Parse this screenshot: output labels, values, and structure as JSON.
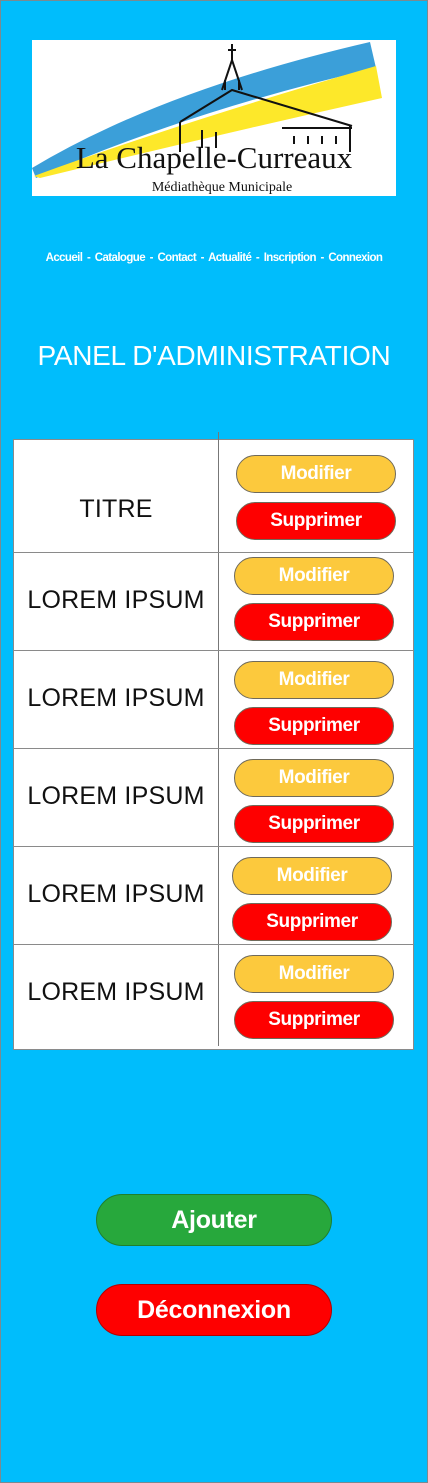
{
  "logo": {
    "title": "La Chapelle-Curreaux",
    "subtitle": "Médiathèque Municipale",
    "colors": {
      "blue": "#3b9fd9",
      "yellow": "#fde82a"
    }
  },
  "nav": {
    "items": [
      "Accueil",
      "Catalogue",
      "Contact",
      "Actualité",
      "Inscription",
      "Connexion"
    ],
    "separator": "-"
  },
  "page": {
    "title": "PANEL D'ADMINISTRATION"
  },
  "table": {
    "rows": [
      {
        "label": "TITRE",
        "edit_label": "Modifier",
        "delete_label": "Supprimer"
      },
      {
        "label": "LOREM IPSUM",
        "edit_label": "Modifier",
        "delete_label": "Supprimer"
      },
      {
        "label": "LOREM IPSUM",
        "edit_label": "Modifier",
        "delete_label": "Supprimer"
      },
      {
        "label": "LOREM IPSUM",
        "edit_label": "Modifier",
        "delete_label": "Supprimer"
      },
      {
        "label": "LOREM IPSUM",
        "edit_label": "Modifier",
        "delete_label": "Supprimer"
      },
      {
        "label": "LOREM IPSUM",
        "edit_label": "Modifier",
        "delete_label": "Supprimer"
      }
    ]
  },
  "actions": {
    "add_label": "Ajouter",
    "logout_label": "Déconnexion"
  },
  "colors": {
    "background": "#00bdfc",
    "modify": "#fcc93d",
    "delete": "#fe0000",
    "add": "#27a83c"
  }
}
